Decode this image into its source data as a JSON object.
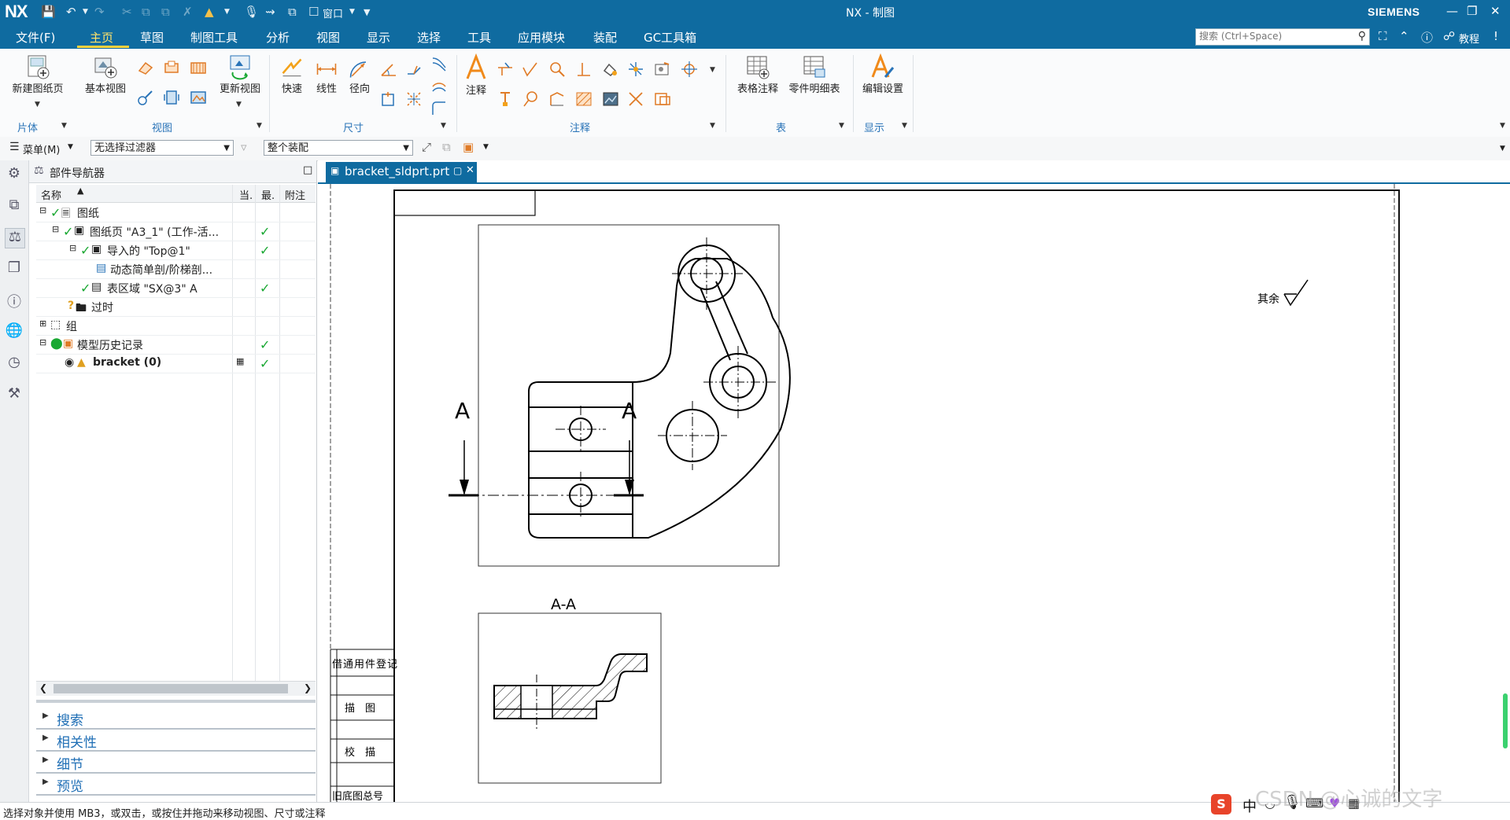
{
  "titlebar": {
    "logo": "NX",
    "title": "NX - 制图",
    "brand": "SIEMENS",
    "window_menu": "窗口"
  },
  "menubar": {
    "items": [
      "文件(F)",
      "主页",
      "草图",
      "制图工具",
      "分析",
      "视图",
      "显示",
      "选择",
      "工具",
      "应用模块",
      "装配",
      "GC工具箱"
    ],
    "active": "主页",
    "search_placeholder": "搜索 (Ctrl+Space)",
    "help_label": "教程"
  },
  "ribbon": {
    "new_sheet": "新建图纸页",
    "base_view": "基本视图",
    "update_view": "更新视图",
    "quick": "快速",
    "linear": "线性",
    "radial": "径向",
    "note": "注释",
    "table_note": "表格注释",
    "parts_list": "零件明细表",
    "edit_settings": "编辑设置",
    "groups": {
      "sheet": "片体",
      "view": "视图",
      "dimension": "尺寸",
      "annotation": "注释",
      "table": "表",
      "display": "显示"
    }
  },
  "filterbar": {
    "menu": "菜单(M)",
    "filter": "无选择过滤器",
    "scope": "整个装配"
  },
  "navigator": {
    "title": "部件导航器",
    "columns": {
      "name": "名称",
      "current": "当.",
      "latest": "最.",
      "note": "附注"
    },
    "rows": [
      {
        "label": "图纸"
      },
      {
        "label": "图纸页 \"A3_1\" (工作-活..."
      },
      {
        "label": "导入的 \"Top@1\""
      },
      {
        "label": "动态简单剖/阶梯剖..."
      },
      {
        "label": "表区域 \"SX@3\" A"
      },
      {
        "label": "过时"
      },
      {
        "label": "组"
      },
      {
        "label": "模型历史记录"
      },
      {
        "label": "bracket (0)"
      }
    ],
    "sections": [
      "搜索",
      "相关性",
      "细节",
      "预览"
    ]
  },
  "document_tab": {
    "label": "bracket_sldprt.prt"
  },
  "drawing": {
    "section_label_left": "A",
    "section_label_right": "A",
    "section_view_label": "A-A",
    "roughness_note": "其余",
    "title_block": [
      "借通用件登记",
      "描　图",
      "校　描",
      "旧底图总号"
    ]
  },
  "status": {
    "text": "选择对象并使用 MB3，或双击，或按住并拖动来移动视图、尺寸或注释"
  },
  "ime": {
    "brand": "S",
    "lang": "中",
    "watermark": "CSDN @心诚的文字"
  }
}
